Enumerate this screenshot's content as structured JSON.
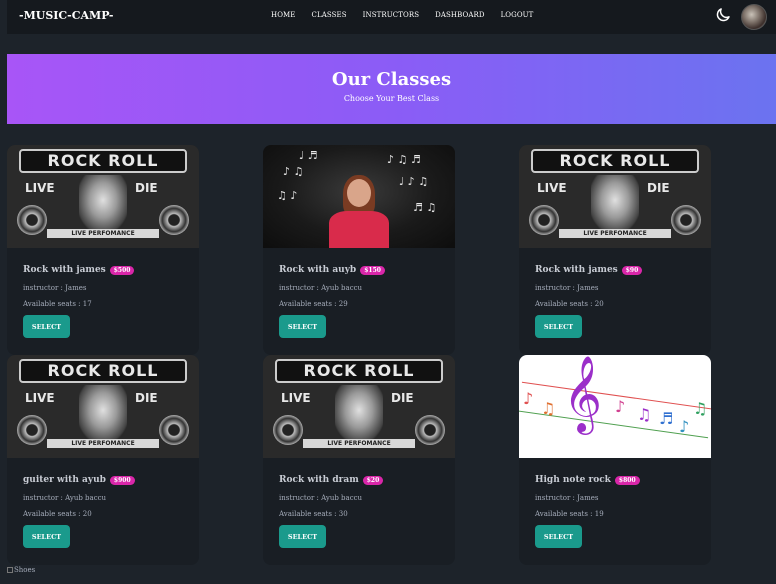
{
  "navbar": {
    "brand": "-MUSIC-CAMP-",
    "links": [
      "HOME",
      "CLASSES",
      "INSTRUCTORS",
      "DASHBOARD",
      "LOGOUT"
    ],
    "theme_icon": "moon-icon"
  },
  "hero": {
    "title": "Our Classes",
    "subtitle": "Choose Your Best Class",
    "gradient_from": "#a855f7",
    "gradient_to": "#6b73f0"
  },
  "poster_text": {
    "banner": "ROCK ROLL",
    "live": "LIVE",
    "die": "DIE",
    "ribbon": "LIVE PERFOMANCE"
  },
  "classes": [
    {
      "name": "Rock with james",
      "price": "$500",
      "instructor": "instructor : James",
      "seats": "Available seats : 17",
      "button": "SELECT"
    },
    {
      "name": "Rock with auyb",
      "price": "$150",
      "instructor": "instructor : Ayub baccu",
      "seats": "Available seats : 29",
      "button": "SELECT"
    },
    {
      "name": "Rock with james",
      "price": "$90",
      "instructor": "instructor : James",
      "seats": "Available seats : 20",
      "button": "SELECT"
    },
    {
      "name": "guiter with ayub",
      "price": "$900",
      "instructor": "instructor : Ayub baccu",
      "seats": "Available seats : 20",
      "button": "SELECT"
    },
    {
      "name": "Rock with dram",
      "price": "$20",
      "instructor": "instructor : Ayub baccu",
      "seats": "Available seats : 30",
      "button": "SELECT"
    },
    {
      "name": "High note rock",
      "price": "$800",
      "instructor": "instructor : James",
      "seats": "Available seats : 19",
      "button": "SELECT"
    }
  ],
  "footer_image_alt": "Shoes",
  "colors": {
    "background": "#1d232a",
    "navbar": "#15191e",
    "badge": "#d926a9",
    "button": "#1a9a8c"
  }
}
